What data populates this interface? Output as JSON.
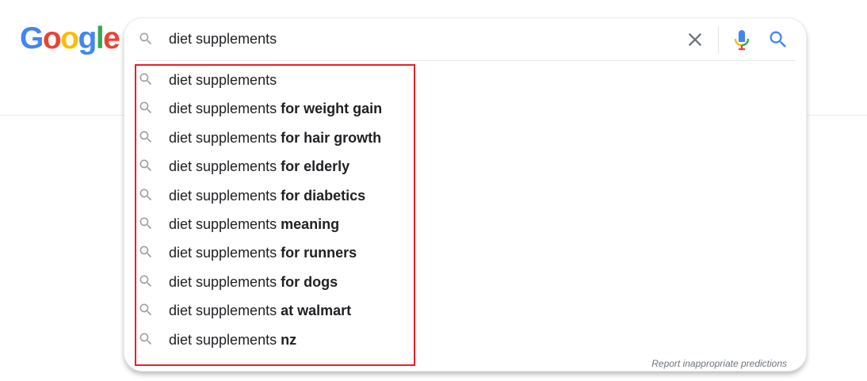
{
  "logo": {
    "letters": [
      "G",
      "o",
      "o",
      "g",
      "l",
      "e"
    ]
  },
  "search": {
    "query": "diet supplements",
    "clear_icon": "close-icon",
    "mic_icon": "microphone-icon",
    "search_icon": "search-icon"
  },
  "suggestions": [
    {
      "prefix": "diet supplements",
      "completion": ""
    },
    {
      "prefix": "diet supplements ",
      "completion": "for weight gain"
    },
    {
      "prefix": "diet supplements ",
      "completion": "for hair growth"
    },
    {
      "prefix": "diet supplements ",
      "completion": "for elderly"
    },
    {
      "prefix": "diet supplements ",
      "completion": "for diabetics"
    },
    {
      "prefix": "diet supplements ",
      "completion": "meaning"
    },
    {
      "prefix": "diet supplements ",
      "completion": "for runners"
    },
    {
      "prefix": "diet supplements ",
      "completion": "for dogs"
    },
    {
      "prefix": "diet supplements ",
      "completion": "at walmart"
    },
    {
      "prefix": "diet supplements ",
      "completion": "nz"
    }
  ],
  "report_link": "Report inappropriate predictions",
  "colors": {
    "google_blue": "#4285F4",
    "google_red": "#EA4335",
    "google_yellow": "#FBBC05",
    "google_green": "#34A853",
    "highlight_red": "#e8202a"
  }
}
